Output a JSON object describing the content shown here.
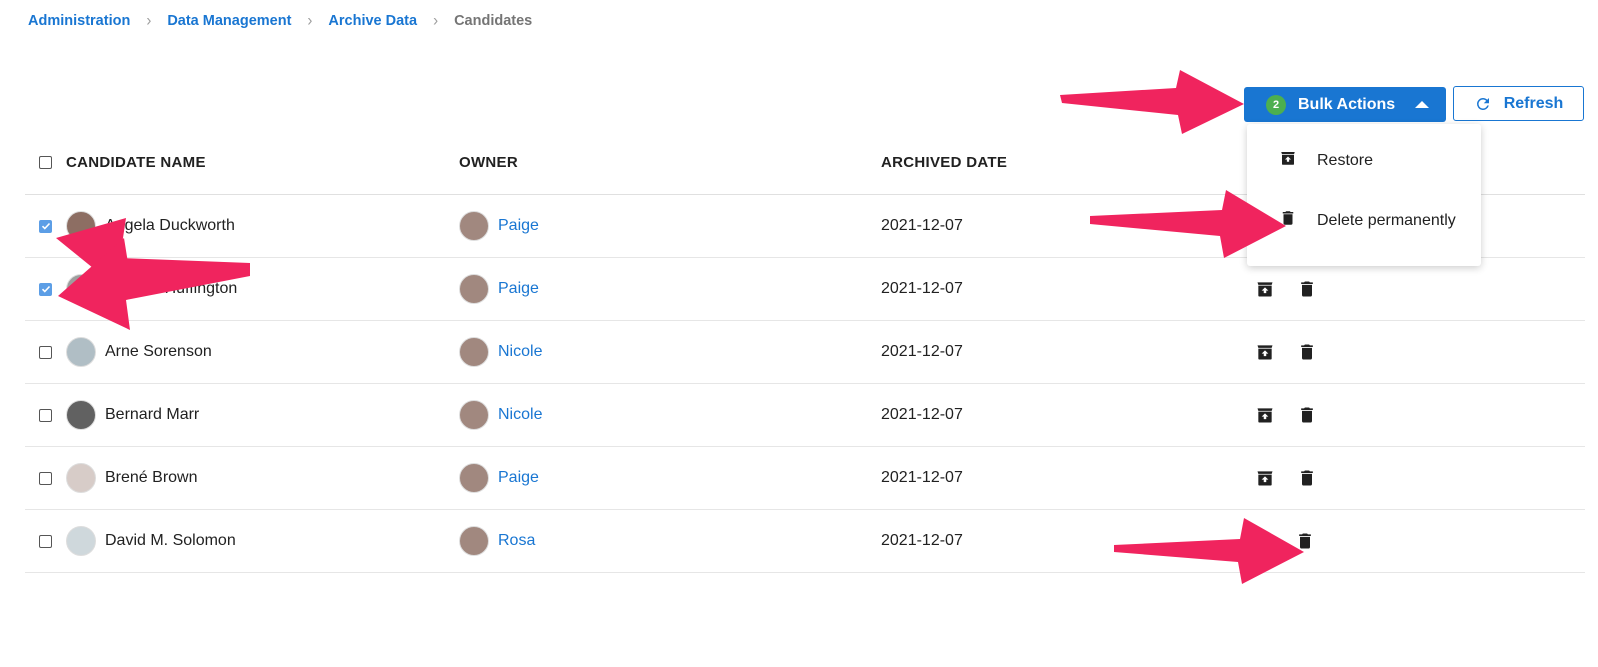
{
  "breadcrumb": {
    "items": [
      "Administration",
      "Data Management",
      "Archive Data"
    ],
    "current": "Candidates"
  },
  "toolbar": {
    "bulk_count": "2",
    "bulk_label": "Bulk Actions",
    "refresh_label": "Refresh"
  },
  "bulk_menu": {
    "restore_label": "Restore",
    "delete_label": "Delete permanently"
  },
  "table": {
    "headers": {
      "name": "CANDIDATE NAME",
      "owner": "OWNER",
      "archived_date": "ARCHIVED DATE"
    },
    "rows": [
      {
        "name": "Angela Duckworth",
        "owner": "Paige",
        "date": "2021-12-07",
        "checked": true,
        "actions": [
          "restore",
          "delete"
        ]
      },
      {
        "name": "Arianna Huffington",
        "owner": "Paige",
        "date": "2021-12-07",
        "checked": true,
        "actions": [
          "restore",
          "delete"
        ]
      },
      {
        "name": "Arne Sorenson",
        "owner": "Nicole",
        "date": "2021-12-07",
        "checked": false,
        "actions": [
          "restore",
          "delete"
        ]
      },
      {
        "name": "Bernard Marr",
        "owner": "Nicole",
        "date": "2021-12-07",
        "checked": false,
        "actions": [
          "restore",
          "delete"
        ]
      },
      {
        "name": "Brené Brown",
        "owner": "Paige",
        "date": "2021-12-07",
        "checked": false,
        "actions": [
          "restore",
          "delete"
        ]
      },
      {
        "name": "David M. Solomon",
        "owner": "Rosa",
        "date": "2021-12-07",
        "checked": false,
        "actions": [
          "delete"
        ]
      }
    ]
  },
  "icons": {
    "restore": "archive-restore-icon",
    "delete": "trash-icon",
    "refresh": "refresh-icon",
    "caret": "caret-up-icon"
  },
  "colors": {
    "primary": "#1976d2",
    "badge": "#4caf50",
    "annotation_arrow": "#f0245e",
    "checked": "#5c9ee6"
  }
}
